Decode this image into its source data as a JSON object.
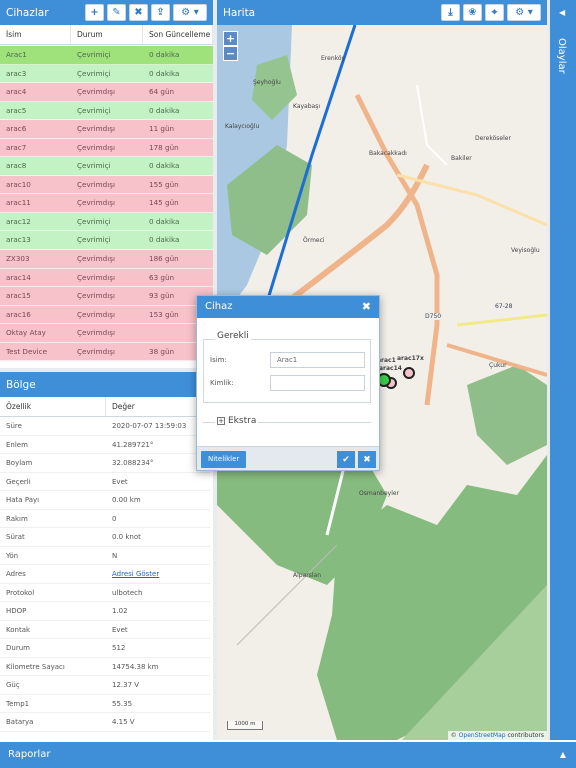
{
  "devices": {
    "title": "Cihazlar",
    "toolbar": {
      "add": "+",
      "edit": "✎",
      "remove": "✖",
      "upload": "⇪",
      "settings": "⚙ ▾"
    },
    "columns": [
      "İsim",
      "Durum",
      "Son Güncelleme"
    ],
    "rows": [
      {
        "name": "Arac1",
        "status": "Çevrimiçi",
        "updated": "0 dakika",
        "state": "online",
        "selected": true
      },
      {
        "name": "arac3",
        "status": "Çevrimiçi",
        "updated": "0 dakika",
        "state": "online"
      },
      {
        "name": "arac4",
        "status": "Çevrimdışı",
        "updated": "64 gün",
        "state": "offline"
      },
      {
        "name": "arac5",
        "status": "Çevrimiçi",
        "updated": "0 dakika",
        "state": "online"
      },
      {
        "name": "arac6",
        "status": "Çevrimdışı",
        "updated": "11 gün",
        "state": "offline"
      },
      {
        "name": "arac7",
        "status": "Çevrimdışı",
        "updated": "178 gün",
        "state": "offline"
      },
      {
        "name": "arac8",
        "status": "Çevrimiçi",
        "updated": "0 dakika",
        "state": "online"
      },
      {
        "name": "arac10",
        "status": "Çevrimdışı",
        "updated": "155 gün",
        "state": "offline"
      },
      {
        "name": "arac11",
        "status": "Çevrimdışı",
        "updated": "145 gün",
        "state": "offline"
      },
      {
        "name": "arac12",
        "status": "Çevrimiçi",
        "updated": "0 dakika",
        "state": "online"
      },
      {
        "name": "arac13",
        "status": "Çevrimiçi",
        "updated": "0 dakika",
        "state": "online"
      },
      {
        "name": "ZX303",
        "status": "Çevrimdışı",
        "updated": "186 gün",
        "state": "offline"
      },
      {
        "name": "arac14",
        "status": "Çevrimdışı",
        "updated": "63 gün",
        "state": "offline"
      },
      {
        "name": "arac15",
        "status": "Çevrimdışı",
        "updated": "93 gün",
        "state": "offline"
      },
      {
        "name": "arac16",
        "status": "Çevrimdışı",
        "updated": "153 gün",
        "state": "offline"
      },
      {
        "name": "Oktay Atay",
        "status": "Çevrimdışı",
        "updated": "",
        "state": "offline"
      },
      {
        "name": "Test Device",
        "status": "Çevrimdışı",
        "updated": "38 gün",
        "state": "offline"
      }
    ]
  },
  "state": {
    "title": "Bölge",
    "columns": [
      "Özellik",
      "Değer"
    ],
    "rows": [
      {
        "key": "Süre",
        "value": "2020-07-07 13:59:03"
      },
      {
        "key": "Enlem",
        "value": "41.289721°"
      },
      {
        "key": "Boylam",
        "value": "32.088234°"
      },
      {
        "key": "Geçerli",
        "value": "Evet"
      },
      {
        "key": "Hata Payı",
        "value": "0.00 km"
      },
      {
        "key": "Rakım",
        "value": "0"
      },
      {
        "key": "Sürat",
        "value": "0.0 knot"
      },
      {
        "key": "Yön",
        "value": "N"
      },
      {
        "key": "Adres",
        "value": "Adresi Göster",
        "link": true
      },
      {
        "key": "Protokol",
        "value": "ulbotech"
      },
      {
        "key": "HDOP",
        "value": "1.02"
      },
      {
        "key": "Kontak",
        "value": "Evet"
      },
      {
        "key": "Durum",
        "value": "512"
      },
      {
        "key": "Kilometre Sayacı",
        "value": "14754.38 km"
      },
      {
        "key": "Güç",
        "value": "12.37 V"
      },
      {
        "key": "Temp1",
        "value": "55.35"
      },
      {
        "key": "Batarya",
        "value": "4.15 V"
      }
    ]
  },
  "map": {
    "title": "Harita",
    "zoom_in": "+",
    "zoom_out": "−",
    "places": {
      "erenkoy": "Erenköy",
      "seyhoglu": "Şeyhoğlu",
      "kayabasi": "Kayabaşı",
      "kalaycioglu": "Kalaycıoğlu",
      "dereokseler": "Dereköseler",
      "bakacakkadi": "Bakacakkadı",
      "bakiler": "Bakiler",
      "ormeci": "Örmeci",
      "veyisoglu": "Veyisoğlu",
      "osmanbeyler": "Osmanbeyler",
      "alparslan": "Alparslan",
      "cukur": "Çukur",
      "d750": "D750",
      "r6728": "67-28",
      "marker1": "arac17x",
      "marker2": "arac14",
      "marker3": "arac1"
    },
    "scale": "1000 m",
    "attribution_prefix": "© ",
    "attribution_link": "OpenStreetMap",
    "attribution_suffix": " contributors"
  },
  "events": {
    "title": "Olaylar"
  },
  "reports": {
    "title": "Raporlar"
  },
  "dialog": {
    "title": "Cihaz",
    "section_required": "Gerekli",
    "name_label": "İsim:",
    "name_value": "Arac1",
    "identifier_label": "Kimlik:",
    "identifier_value": "",
    "section_extra": "Ekstra",
    "attributes_button": "Nitelikler",
    "ok": "✔",
    "cancel": "✖"
  },
  "colors": {
    "accent": "#3f8fd8",
    "online": "#c3f3c4",
    "offline": "#f7c2ca",
    "selected": "#9fe27b"
  }
}
